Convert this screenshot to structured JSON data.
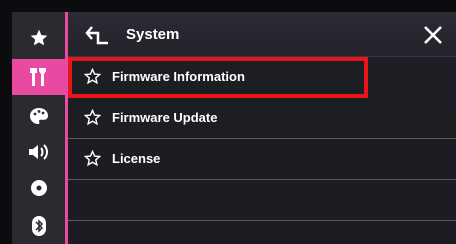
{
  "header": {
    "title": "System",
    "back_icon": "return-arrow-icon",
    "close_icon": "close-icon"
  },
  "sidebar": {
    "items": [
      {
        "icon": "star-icon",
        "active": false
      },
      {
        "icon": "tools-icon",
        "active": true
      },
      {
        "icon": "palette-icon",
        "active": false
      },
      {
        "icon": "speaker-icon",
        "active": false
      },
      {
        "icon": "disc-icon",
        "active": false
      },
      {
        "icon": "bluetooth-icon",
        "active": false
      }
    ]
  },
  "menu": {
    "items": [
      {
        "label": "Firmware Information",
        "icon": "star-outline-icon",
        "highlighted": true
      },
      {
        "label": "Firmware Update",
        "icon": "star-outline-icon",
        "highlighted": false
      },
      {
        "label": "License",
        "icon": "star-outline-icon",
        "highlighted": false
      }
    ]
  },
  "colors": {
    "accent": "#e84aa2",
    "highlight_box": "#e8141c",
    "background": "#1e1f24"
  }
}
